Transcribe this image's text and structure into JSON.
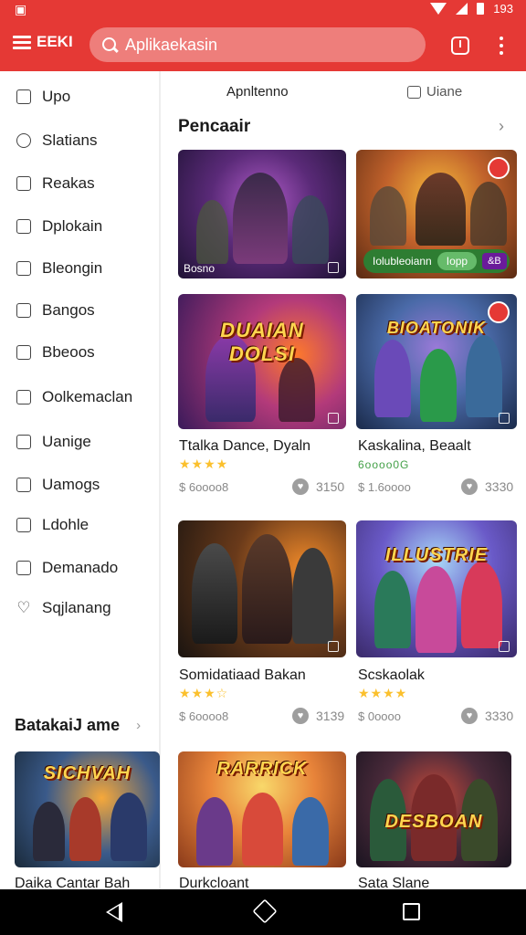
{
  "status_bar": {
    "time": "193"
  },
  "app_bar": {
    "menu_label": "EEKI",
    "search_placeholder": "Aplikaekasin"
  },
  "sidebar": {
    "items": [
      {
        "label": "Upo",
        "icon": "edit-icon"
      },
      {
        "label": "Slatians",
        "icon": "person-icon"
      },
      {
        "label": "Reakas",
        "icon": "calendar-icon"
      },
      {
        "label": "Dplokain",
        "icon": "square-icon"
      },
      {
        "label": "Bleongin",
        "icon": "calendar-icon"
      },
      {
        "label": "Bangos",
        "icon": "home-icon"
      },
      {
        "label": "Bbeoos",
        "icon": "book-icon"
      },
      {
        "label": "Oolkemaclan",
        "icon": "grid-icon"
      },
      {
        "label": "Uanige",
        "icon": "clipboard-icon"
      },
      {
        "label": "Uamogs",
        "icon": "square-icon"
      },
      {
        "label": "Ldohle",
        "icon": "puzzle-icon"
      },
      {
        "label": "Demanado",
        "icon": "home-icon"
      },
      {
        "label": "Sqjlanang",
        "icon": "heart-icon"
      }
    ],
    "section_title": "BatakaiJ ame"
  },
  "tabs": [
    {
      "label": "Apnltenno"
    },
    {
      "label": "Uiane"
    }
  ],
  "main": {
    "section_title": "Pencaair",
    "featured": [
      {
        "caption": "Bosno"
      },
      {
        "promo_text": "Iolubleoiann",
        "promo_pill": "Iopp",
        "promo_tag": "&B"
      }
    ],
    "games_row1": [
      {
        "logo": "DUAIAN DOLSI",
        "title": "Ttalka Dance, Dyaln",
        "stars": "★★★★",
        "meta": "$ 6oooo8",
        "price": "3150"
      },
      {
        "logo": "BIOATONIK",
        "title": "Kaskalina, Beaalt",
        "stars": "6oooo0G",
        "meta": "$ 1.6oooo",
        "price": "3330"
      }
    ],
    "games_row2": [
      {
        "title": "Somidatiaad Bakan",
        "stars": "★★★☆",
        "meta": "$ 6oooo8",
        "price": "3139"
      },
      {
        "logo": "ILLUSTRIE",
        "title": "Scskaolak",
        "stars": "★★★★",
        "meta": "$ 0oooo",
        "price": "3330"
      }
    ],
    "games_row3": [
      {
        "logo": "SICHVAH",
        "title": "Daika Cantar Bah"
      },
      {
        "logo": "RARRICK",
        "title": "Durkcloant"
      },
      {
        "logo": "DESBOAN",
        "title": "Sata Slane"
      }
    ]
  },
  "colors": {
    "accent": "#e53935",
    "star": "#fbc02d",
    "promo_green": "#2e7d32"
  }
}
